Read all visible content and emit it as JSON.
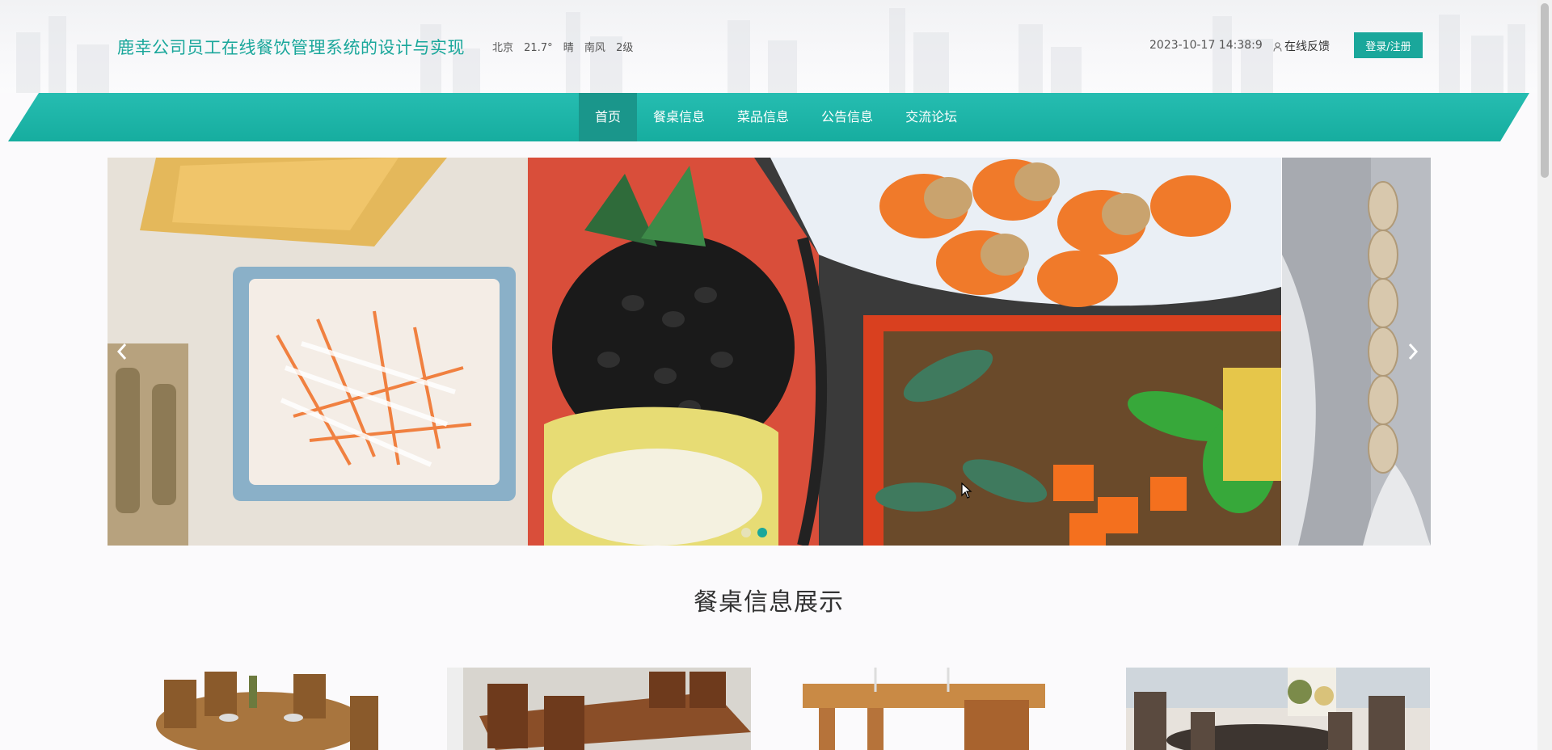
{
  "header": {
    "title": "鹿幸公司员工在线餐饮管理系统的设计与实现",
    "weather": {
      "city": "北京",
      "temperature": "21.7°",
      "condition": "晴",
      "wind": "南风",
      "level": "2级"
    },
    "datetime": "2023-10-17 14:38:9",
    "feedback_label": "在线反馈",
    "login_label": "登录/注册"
  },
  "nav": {
    "items": [
      {
        "label": "首页",
        "active": true
      },
      {
        "label": "餐桌信息",
        "active": false
      },
      {
        "label": "菜品信息",
        "active": false
      },
      {
        "label": "公告信息",
        "active": false
      },
      {
        "label": "交流论坛",
        "active": false
      }
    ]
  },
  "banner": {
    "slide_count": 2,
    "active_slide": 2,
    "prev_icon": "chevron-left-icon",
    "next_icon": "chevron-right-icon"
  },
  "section": {
    "title": "餐桌信息展示",
    "card_count": 4
  },
  "colors": {
    "accent": "#1aa79b",
    "nav_active": "#1a968b",
    "background": "#fbfafc"
  }
}
